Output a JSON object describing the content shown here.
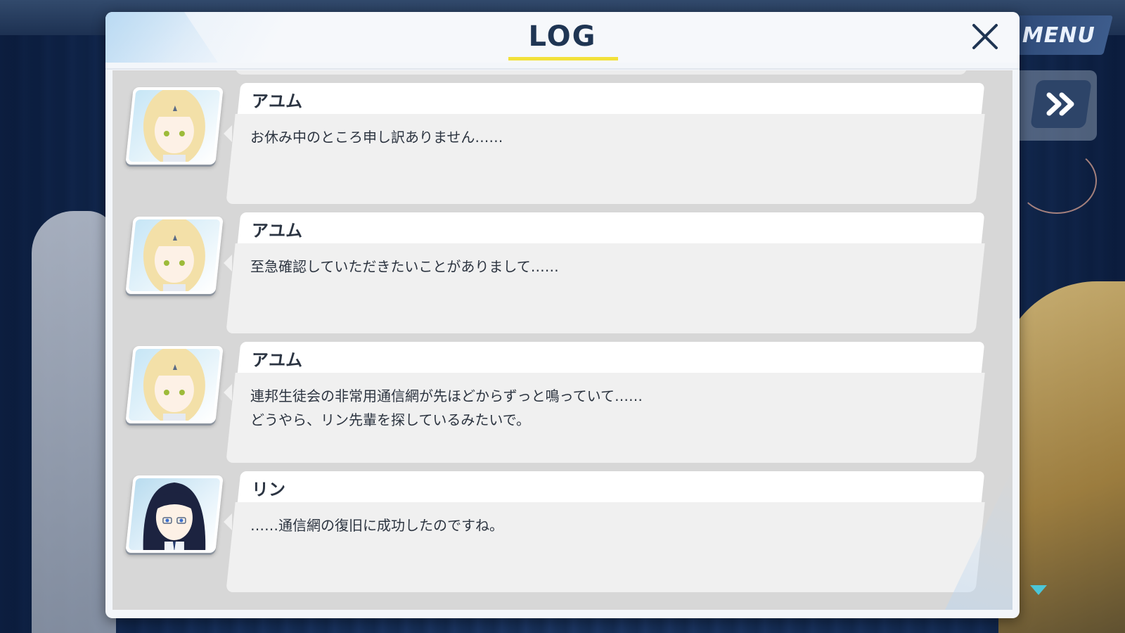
{
  "menu": {
    "label": "MENU"
  },
  "log": {
    "title": "LOG",
    "entries": [
      {
        "speaker": "アユム",
        "portrait": "ayumu-portrait",
        "text": "お休み中のところ申し訳ありません……"
      },
      {
        "speaker": "アユム",
        "portrait": "ayumu-portrait",
        "text": "至急確認していただきたいことがありまして……"
      },
      {
        "speaker": "アユム",
        "portrait": "ayumu-portrait",
        "text": "連邦生徒会の非常用通信網が先ほどからずっと鳴っていて……\nどうやら、リン先輩を探しているみたいで。"
      },
      {
        "speaker": "リン",
        "portrait": "rin-portrait",
        "text": "……通信網の復旧に成功したのですね。"
      }
    ]
  },
  "icons": {
    "close": "close-icon",
    "skip": "fast-forward-icon",
    "scroll": "scroll-down-icon"
  },
  "colors": {
    "title": "#1f3553",
    "title_underline": "#f2e13a",
    "accent_cyan": "#4cc6d8",
    "dialog_bg": "#f3f6fa",
    "list_bg": "#d7d7d7"
  }
}
